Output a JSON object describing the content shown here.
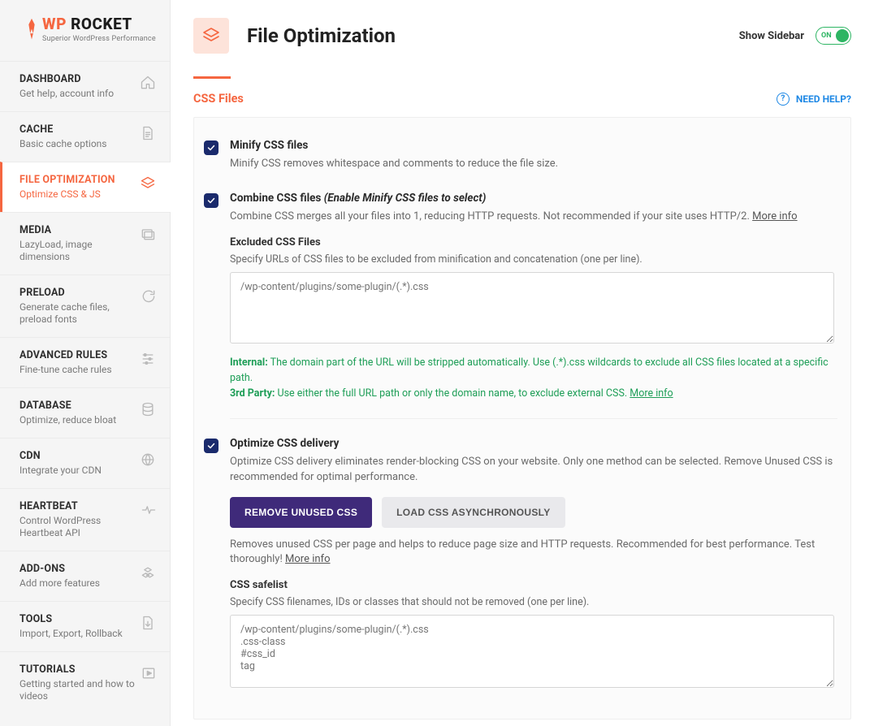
{
  "logo": {
    "brand_a": "WP",
    "brand_b": "ROCKET",
    "sub": "Superior WordPress Performance"
  },
  "sidebar": {
    "items": [
      {
        "title": "DASHBOARD",
        "sub": "Get help, account info"
      },
      {
        "title": "CACHE",
        "sub": "Basic cache options"
      },
      {
        "title": "FILE OPTIMIZATION",
        "sub": "Optimize CSS & JS"
      },
      {
        "title": "MEDIA",
        "sub": "LazyLoad, image dimensions"
      },
      {
        "title": "PRELOAD",
        "sub": "Generate cache files, preload fonts"
      },
      {
        "title": "ADVANCED RULES",
        "sub": "Fine-tune cache rules"
      },
      {
        "title": "DATABASE",
        "sub": "Optimize, reduce bloat"
      },
      {
        "title": "CDN",
        "sub": "Integrate your CDN"
      },
      {
        "title": "HEARTBEAT",
        "sub": "Control WordPress Heartbeat API"
      },
      {
        "title": "ADD-ONS",
        "sub": "Add more features"
      },
      {
        "title": "TOOLS",
        "sub": "Import, Export, Rollback"
      },
      {
        "title": "TUTORIALS",
        "sub": "Getting started and how to videos"
      }
    ]
  },
  "header": {
    "page_title": "File Optimization",
    "show_sidebar": "Show Sidebar",
    "toggle_label": "ON"
  },
  "section": {
    "title": "CSS Files",
    "need_help": "NEED HELP?"
  },
  "css": {
    "minify": {
      "label": "Minify CSS files",
      "desc": "Minify CSS removes whitespace and comments to reduce the file size."
    },
    "combine": {
      "label": "Combine CSS files",
      "hint": "(Enable Minify CSS files to select)",
      "desc": "Combine CSS merges all your files into 1, reducing HTTP requests. Not recommended if your site uses HTTP/2.",
      "more": "More info",
      "excluded_label": "Excluded CSS Files",
      "excluded_desc": "Specify URLs of CSS files to be excluded from minification and concatenation (one per line).",
      "excluded_placeholder": "/wp-content/plugins/some-plugin/(.*).css",
      "note_internal_lead": "Internal:",
      "note_internal": " The domain part of the URL will be stripped automatically. Use (.*).css wildcards to exclude all CSS files located at a specific path.",
      "note_third_lead": "3rd Party:",
      "note_third": " Use either the full URL path or only the domain name, to exclude external CSS. ",
      "note_more": "More info"
    },
    "optimize": {
      "label": "Optimize CSS delivery",
      "desc": "Optimize CSS delivery eliminates render-blocking CSS on your website. Only one method can be selected. Remove Unused CSS is recommended for optimal performance.",
      "btn_primary": "REMOVE UNUSED CSS",
      "btn_secondary": "LOAD CSS ASYNCHRONOUSLY",
      "after_desc": "Removes unused CSS per page and helps to reduce page size and HTTP requests. Recommended for best performance. Test thoroughly!",
      "after_more": "More info",
      "safelist_label": "CSS safelist",
      "safelist_desc": "Specify CSS filenames, IDs or classes that should not be removed (one per line).",
      "safelist_placeholder": "/wp-content/plugins/some-plugin/(.*).css\n.css-class\n#css_id\ntag"
    }
  }
}
